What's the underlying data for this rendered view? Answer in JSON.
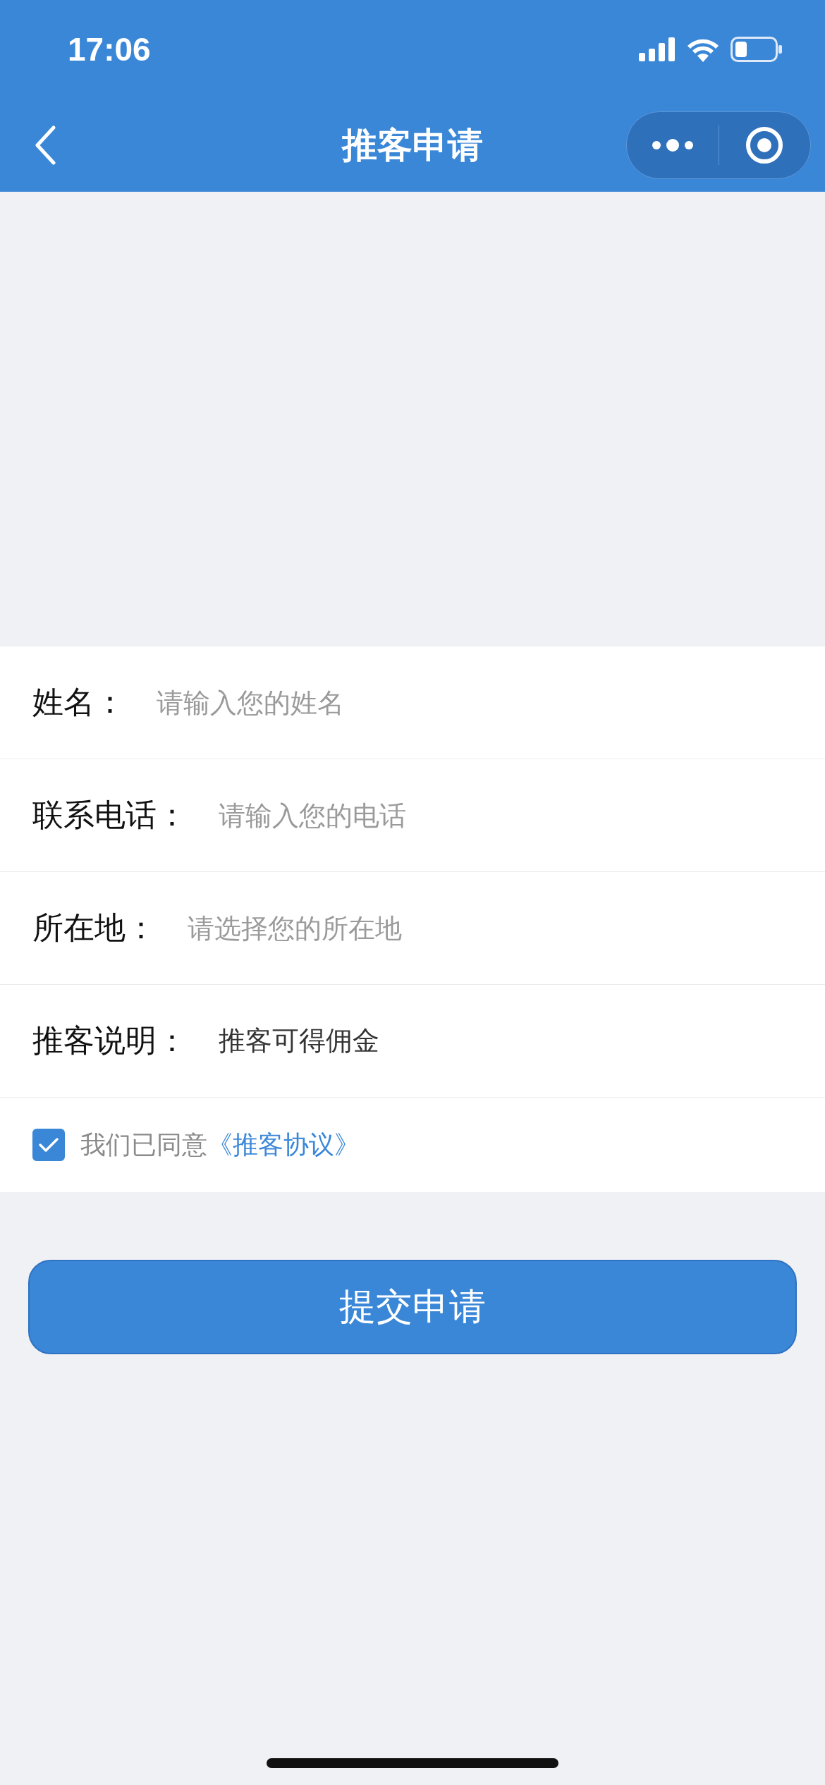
{
  "status_bar": {
    "time": "17:06"
  },
  "nav": {
    "title": "推客申请"
  },
  "form": {
    "fields": [
      {
        "label": "姓名：",
        "placeholder": "请输入您的姓名"
      },
      {
        "label": "联系电话：",
        "placeholder": "请输入您的电话"
      },
      {
        "label": "所在地：",
        "placeholder": "请选择您的所在地"
      },
      {
        "label": "推客说明：",
        "value": "推客可得佣金"
      }
    ],
    "agreement": {
      "checked": true,
      "text": "我们已同意",
      "link": "《推客协议》"
    }
  },
  "submit_button": "提交申请"
}
